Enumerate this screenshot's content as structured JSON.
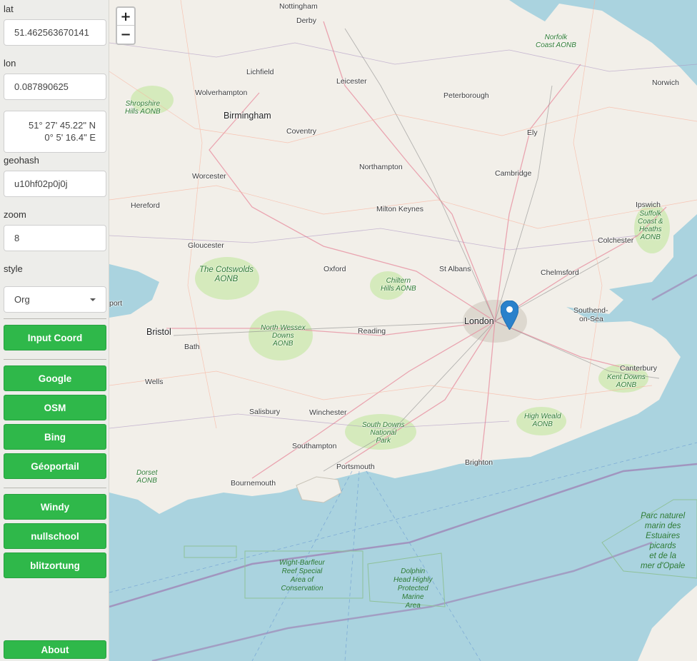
{
  "sidebar": {
    "lat_label": "lat",
    "lat_value": "51.462563670141",
    "lon_label": "lon",
    "lon_value": "0.087890625",
    "dms_lat": "51° 27' 45.22\" N",
    "dms_lon": "0° 5' 16.4\" E",
    "geohash_label": "geohash",
    "geohash_value": "u10hf02p0j0j",
    "zoom_label": "zoom",
    "zoom_value": "8",
    "style_label": "style",
    "style_value": "Org",
    "buttons": {
      "input_coord": "Input Coord",
      "google": "Google",
      "osm": "OSM",
      "bing": "Bing",
      "geoportail": "Géoportail",
      "windy": "Windy",
      "nullschool": "nullschool",
      "blitzortung": "blitzortung",
      "about": "About"
    }
  },
  "map": {
    "zoom_in": "+",
    "zoom_out": "−",
    "colors": {
      "sea": "#aad3df",
      "land": "#f2efe9",
      "park": "#cde8b0",
      "marker": "#2a81cb"
    },
    "places": {
      "derby": "Derby",
      "nottingham": "Nottingham",
      "lichfield": "Lichfield",
      "wolverhampton": "Wolverhampton",
      "birmingham": "Birmingham",
      "coventry": "Coventry",
      "leicester": "Leicester",
      "peterborough": "Peterborough",
      "norwich": "Norwich",
      "ely": "Ely",
      "worcester": "Worcester",
      "northampton": "Northampton",
      "cambridge": "Cambridge",
      "hereford": "Hereford",
      "milton_keynes": "Milton Keynes",
      "ipswich": "Ipswich",
      "gloucester": "Gloucester",
      "colchester": "Colchester",
      "oxford": "Oxford",
      "st_albans": "St Albans",
      "chelmsford": "Chelmsford",
      "london": "London",
      "southend": "Southend-",
      "southend2": "on-Sea",
      "bristol": "Bristol",
      "reading": "Reading",
      "bath": "Bath",
      "canterbury": "Canterbury",
      "wells": "Wells",
      "salisbury": "Salisbury",
      "winchester": "Winchester",
      "southampton": "Southampton",
      "portsmouth": "Portsmouth",
      "brighton": "Brighton",
      "bournemouth": "Bournemouth",
      "port": "port"
    },
    "areas": {
      "norfolk": [
        "Norfolk",
        "Coast AONB"
      ],
      "shropshire": [
        "Shropshire",
        "Hills AONB"
      ],
      "suffolk": [
        "Suffolk",
        "Coast &",
        "Heaths",
        "AONB"
      ],
      "cotswolds": [
        "The Cotswolds",
        "AONB"
      ],
      "chiltern": [
        "Chiltern",
        "Hills AONB"
      ],
      "north_wessex": [
        "North Wessex",
        "Downs",
        "AONB"
      ],
      "kent_downs": [
        "Kent Downs",
        "AONB"
      ],
      "high_weald": [
        "High Weald",
        "AONB"
      ],
      "south_downs": [
        "South Downs",
        "National",
        "Park"
      ],
      "dorset": [
        "Dorset",
        "AONB"
      ],
      "wight_barfleur": [
        "Wight-Barfleur",
        "Reef Special",
        "Area of",
        "Conservation"
      ],
      "dolphin_head": [
        "Dolphin",
        "Head Highly",
        "Protected",
        "Marine",
        "Area"
      ],
      "parc_naturel": [
        "Parc naturel",
        "marin des",
        "Estuaires",
        "picards",
        "et de la",
        "mer d'Opale"
      ]
    }
  }
}
